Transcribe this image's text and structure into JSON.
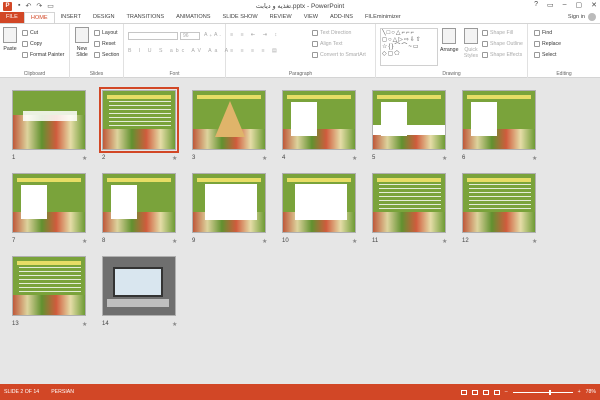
{
  "window": {
    "title": "تغذیه و دیابت.pptx - PowerPoint",
    "controls": [
      "?",
      "▭",
      "–",
      "▢",
      "✕"
    ]
  },
  "tabs": [
    "FILE",
    "HOME",
    "INSERT",
    "DESIGN",
    "TRANSITIONS",
    "ANIMATIONS",
    "SLIDE SHOW",
    "REVIEW",
    "VIEW",
    "ADD-INS",
    "FILEminimizer"
  ],
  "active_tab": "HOME",
  "signin": "Sign in",
  "ribbon": {
    "clipboard": {
      "label": "Clipboard",
      "paste": "Paste",
      "cut": "Cut",
      "copy": "Copy",
      "format_painter": "Format Painter"
    },
    "slides": {
      "label": "Slides",
      "new_slide": "New Slide",
      "layout": "Layout",
      "reset": "Reset",
      "section": "Section"
    },
    "font": {
      "label": "Font",
      "size": "96"
    },
    "paragraph": {
      "label": "Paragraph",
      "text_direction": "Text Direction",
      "align_text": "Align Text",
      "convert_smartart": "Convert to SmartArt"
    },
    "drawing": {
      "label": "Drawing",
      "arrange": "Arrange",
      "quick_styles": "Quick Styles",
      "shape_fill": "Shape Fill",
      "shape_outline": "Shape Outline",
      "shape_effects": "Shape Effects"
    },
    "editing": {
      "label": "Editing",
      "find": "Find",
      "replace": "Replace",
      "select": "Select"
    }
  },
  "slides": [
    {
      "num": "1",
      "kind": "title",
      "selected": false
    },
    {
      "num": "2",
      "kind": "text",
      "selected": true
    },
    {
      "num": "3",
      "kind": "pyramid",
      "selected": false
    },
    {
      "num": "4",
      "kind": "table",
      "selected": false
    },
    {
      "num": "5",
      "kind": "table-white",
      "selected": false
    },
    {
      "num": "6",
      "kind": "table",
      "selected": false
    },
    {
      "num": "7",
      "kind": "table",
      "selected": false
    },
    {
      "num": "8",
      "kind": "table",
      "selected": false
    },
    {
      "num": "9",
      "kind": "table-wide",
      "selected": false
    },
    {
      "num": "10",
      "kind": "table-wide",
      "selected": false
    },
    {
      "num": "11",
      "kind": "text",
      "selected": false
    },
    {
      "num": "12",
      "kind": "text",
      "selected": false
    },
    {
      "num": "13",
      "kind": "text",
      "selected": false
    },
    {
      "num": "14",
      "kind": "laptop",
      "selected": false
    }
  ],
  "status": {
    "slide_info": "SLIDE 2 OF 14",
    "language": "PERSIAN",
    "zoom": "78%"
  }
}
